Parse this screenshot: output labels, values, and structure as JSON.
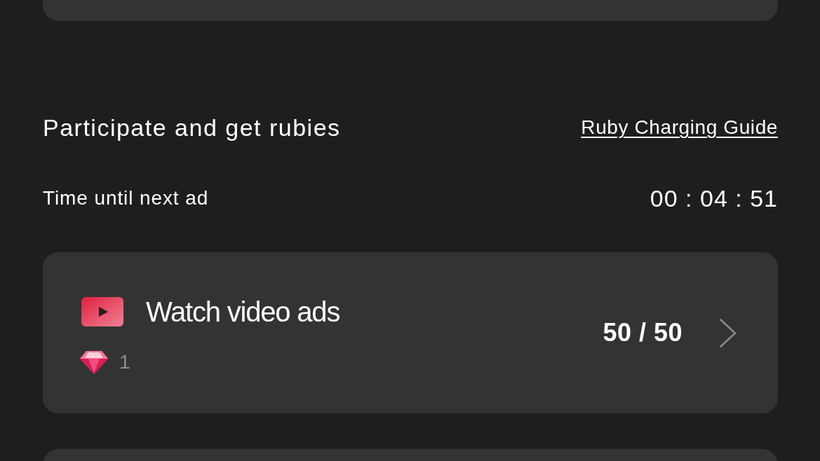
{
  "section": {
    "title": "Participate and get rubies",
    "guide_link": "Ruby Charging Guide"
  },
  "timer": {
    "label": "Time until next ad",
    "value": "00 : 04 : 51"
  },
  "tasks": [
    {
      "kind": "video",
      "title": "Watch video ads",
      "reward": "1",
      "progress": "50 / 50"
    }
  ]
}
